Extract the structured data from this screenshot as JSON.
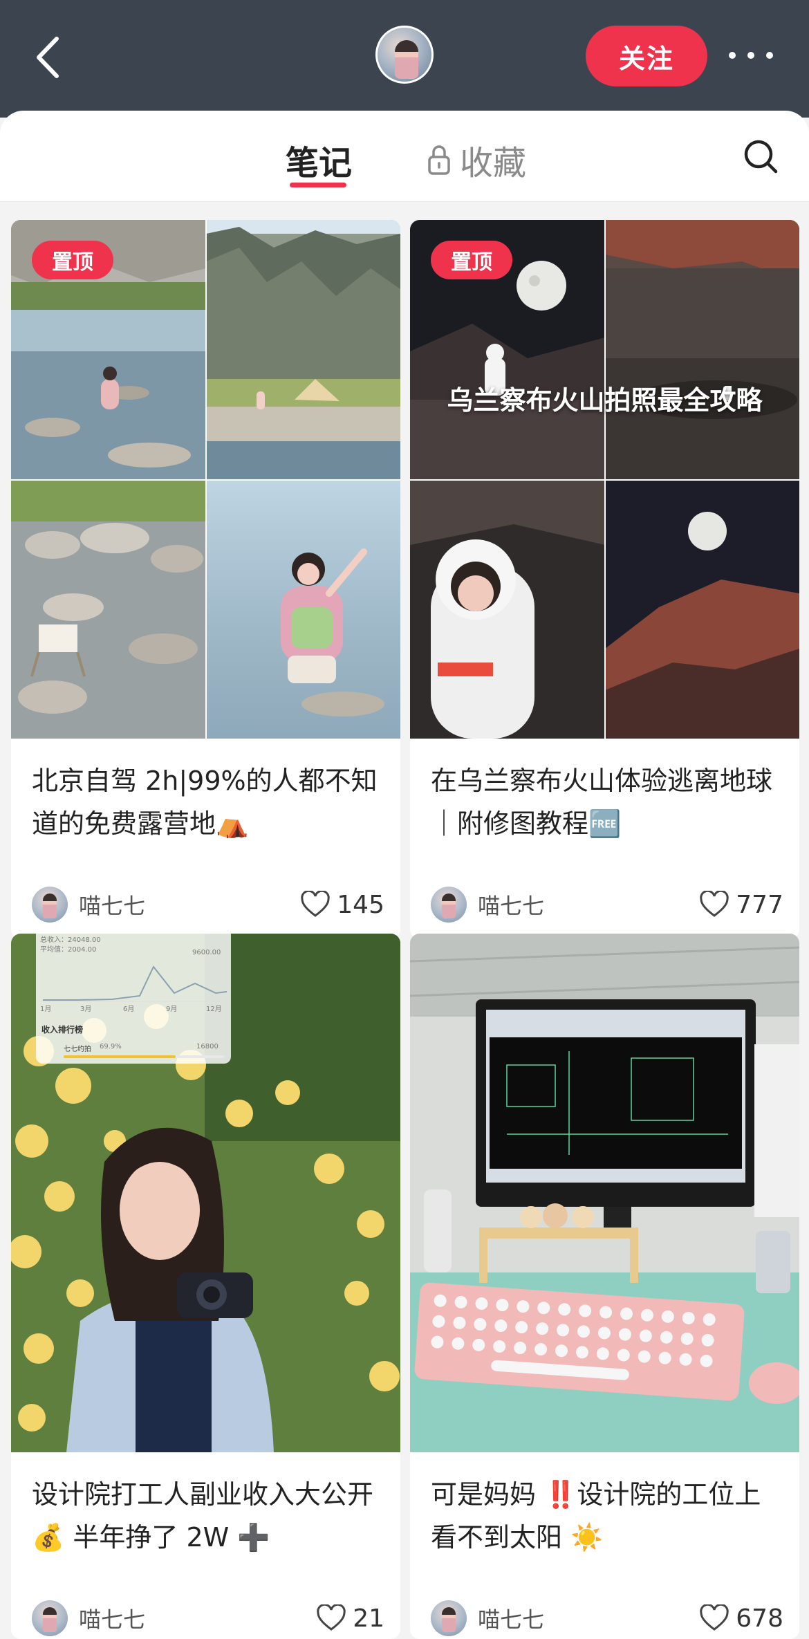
{
  "header": {
    "follow_label": "关注"
  },
  "tabs": {
    "notes_label": "笔记",
    "favorites_label": "收藏"
  },
  "colors": {
    "header_bg": "#3c4450",
    "accent": "#f0334d"
  },
  "cards": [
    {
      "pinned_label": "置顶",
      "title": "北京自驾 2h|99%的人都不知道的免费露营地⛺",
      "author": "喵七七",
      "likes": "145"
    },
    {
      "pinned_label": "置顶",
      "cover_text": "乌兰察布火山拍照最全攻略",
      "title": "在乌兰察布火山体验逃离地球｜附修图教程🆓",
      "author": "喵七七",
      "likes": "777"
    },
    {
      "overlay": {
        "total_income": "总收入：24048.00",
        "average": "平均值：2004.00",
        "peak": "9600.00",
        "months": [
          "1月",
          "3月",
          "6月",
          "9月",
          "12月"
        ],
        "rank_title": "收入排行榜",
        "rank_name": "七七约拍",
        "rank_percent": "69.9%",
        "rank_value": "16800",
        "rank_fill": 0.7
      },
      "title": "设计院打工人副业收入大公开 💰 半年挣了 2W ➕",
      "author": "喵七七",
      "likes": "21"
    },
    {
      "title": "可是妈妈 ‼️设计院的工位上看不到太阳 ☀️",
      "author": "喵七七",
      "likes": "678"
    }
  ]
}
